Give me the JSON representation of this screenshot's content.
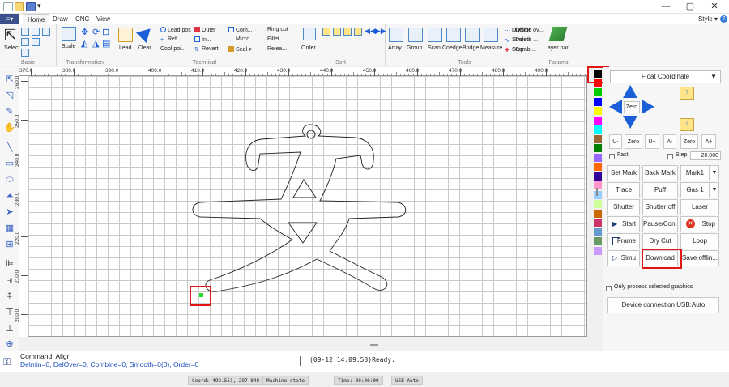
{
  "window": {
    "minimize": "—",
    "restore": "▢",
    "close": "✕"
  },
  "tabs": {
    "items": [
      "Home",
      "Draw",
      "CNC",
      "View"
    ],
    "style_label": "Style ▾",
    "help": "?"
  },
  "ribbon": {
    "groups": {
      "basic": "Basic",
      "transformation": "Transformation",
      "technical": "Technical",
      "sort": "Sort",
      "tools": "Tools",
      "params": "Params"
    },
    "buttons": {
      "select": "Select",
      "scale": "Scale",
      "lead": "Lead",
      "clear": "Clear",
      "lead_pos": "Lead pos",
      "ref": "Ref",
      "cool_point": "Cool poi...",
      "outer": "Outer",
      "in": "In...",
      "revert": "Revert",
      "com": "Com...",
      "micro": "Micro",
      "seal": "Seal ▾",
      "ring_cut": "Ring cut",
      "fillet": "Fillet",
      "release": "Relea...",
      "order": "Order",
      "array": "Array",
      "group": "Group",
      "scan": "Scan",
      "coedge": "Coedge",
      "bridge": "Bridge",
      "measure": "Measure",
      "division": "Division",
      "smooth": "Smooth",
      "stop": "Stop...",
      "delete_ov": "Delete ov...",
      "delete": "Delete ...",
      "combi": "Combi...",
      "layer_par": "ayer par"
    }
  },
  "ruler": {
    "h": [
      "370.0",
      "380.0",
      "390.0",
      "400.0",
      "410.0",
      "420.0",
      "430.0",
      "440.0",
      "450.0",
      "460.0",
      "470.0",
      "480.0",
      "490.0"
    ],
    "v": [
      "260.0",
      "250.0",
      "240.0",
      "230.0",
      "220.0",
      "210.0",
      "200.0"
    ]
  },
  "colors": {
    "palette": [
      "#000000",
      "#ff0000",
      "#00cc00",
      "#0000ff",
      "#ffff00",
      "#ff00ff",
      "#00ffff",
      "#996633",
      "#008000",
      "#9966ff",
      "#ff6600",
      "#330099",
      "#ff99cc",
      "#99ccff",
      "#ccff99",
      "#cc6600",
      "#cc3366",
      "#6699cc",
      "#669966",
      "#cc99ff"
    ],
    "highlight": "#e01616",
    "accent_blue": "#1a5fd8",
    "marker": "#22dd22"
  },
  "panel": {
    "coord_mode": "Float Coordinate",
    "zero": "Zero",
    "u_minus": "U-",
    "u_zero": "Zero",
    "u_plus": "U+",
    "a_minus": "A-",
    "a_zero": "Zero",
    "a_plus": "A+",
    "fast": "Fast",
    "step": "Step",
    "step_value": "20.000",
    "set_mark": "Set Mark",
    "back_mark": "Back Mark",
    "mark_select": "Mark1",
    "trace": "Trace",
    "puff": "Puff",
    "gas_select": "Gas 1",
    "shutter": "Shutter",
    "shutter_off": "Shutter off",
    "laser": "Laser",
    "start": "Start",
    "pause": "Pause/Con...",
    "stop": "Stop",
    "frame": "Frame",
    "dry_cut": "Dry Cut",
    "loop": "Loop",
    "simu": "Simu",
    "download": "Download",
    "save_offline": "Save offlin...",
    "only_selected": "Only process selected graphics",
    "device_conn": "Device connection USB:Auto"
  },
  "command": {
    "line1": "Command: Align",
    "line2": "Delmin=0, DelOver=0, Combine=0, Smooth=0(0), Order=0",
    "log": "(09-12 14:09:58)Ready."
  },
  "status": {
    "coord": "Coord: 493.551, 297.848",
    "machine": "Machine state",
    "time": "Time: 00:00:00",
    "usb": "USB Auto"
  }
}
